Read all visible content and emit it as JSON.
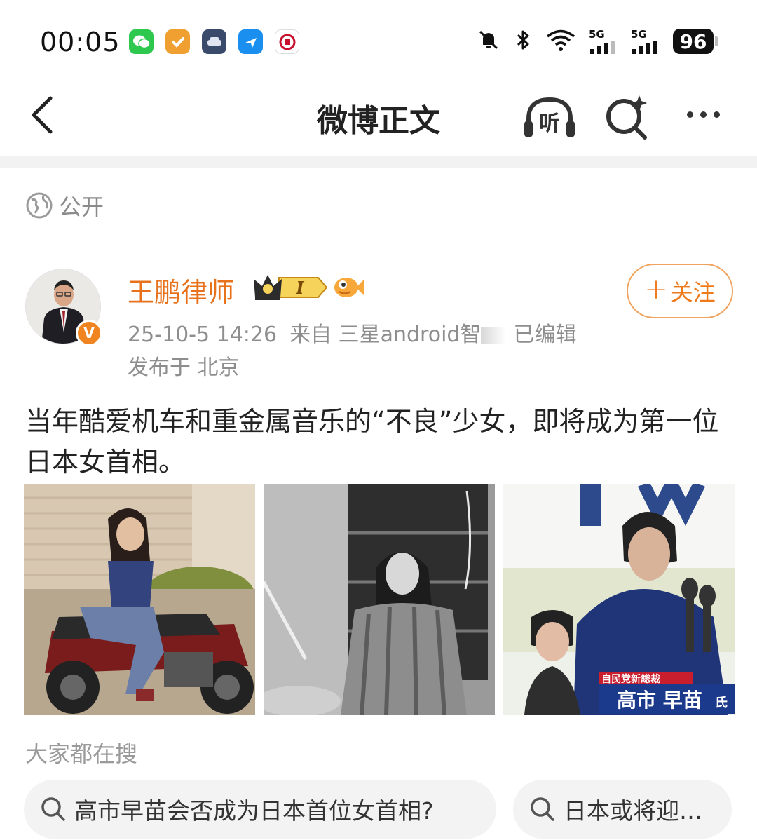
{
  "status_bar": {
    "time": "00:05",
    "app_icons": [
      "wechat-icon",
      "checkmark-app-icon",
      "car-app-icon",
      "flight-app-icon",
      "bank-app-icon"
    ],
    "system_icons": [
      "mute-icon",
      "bluetooth-icon",
      "wifi-icon",
      "signal-5g-icon",
      "signal-5g-icon"
    ],
    "network_label_1": "5G",
    "network_label_2": "5G",
    "battery": "96"
  },
  "nav": {
    "title": "微博正文",
    "listen_label": "听"
  },
  "visibility": {
    "label": "公开",
    "icon": "globe-icon"
  },
  "author": {
    "name": "王鹏律师",
    "verified_mark": "V",
    "badge_level": "I",
    "timestamp": "25-10-5 14:26",
    "source": "来自 三星android智",
    "edited": "已编辑",
    "location": "发布于 北京",
    "follow_label": "关注",
    "follow_plus": "+"
  },
  "post": {
    "text": "当年酷爱机车和重金属音乐的“不良”少女，即将成为第一位日本女首相。",
    "images": [
      {
        "name": "motorcycle-photo"
      },
      {
        "name": "drummer-photo"
      },
      {
        "name": "press-conference-photo",
        "caption_top": "自民党新総裁",
        "caption_main": "高市 早苗",
        "caption_suffix": "氏"
      }
    ]
  },
  "trending": {
    "title": "大家都在搜",
    "chips": [
      {
        "text": "高市早苗会否成为日本首位女首相?"
      },
      {
        "text": "日本或将迎…"
      }
    ]
  },
  "colors": {
    "accent_orange": "#e8721c",
    "follow_border": "#f0a35e",
    "meta_gray": "#8e8e8e",
    "band_gray": "#f2f2f2"
  }
}
